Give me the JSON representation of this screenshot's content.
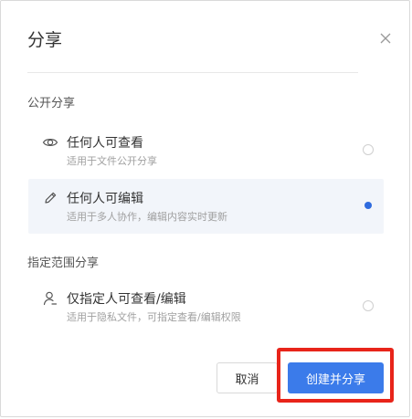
{
  "dialog": {
    "title": "分享",
    "close_icon": "close-icon"
  },
  "public_section": {
    "title": "公开分享",
    "options": [
      {
        "icon": "eye-icon",
        "label": "任何人可查看",
        "description": "适用于文件公开分享",
        "selected": false
      },
      {
        "icon": "pencil-icon",
        "label": "任何人可编辑",
        "description": "适用于多人协作，编辑内容实时更新",
        "selected": true
      }
    ]
  },
  "scoped_section": {
    "title": "指定范围分享",
    "options": [
      {
        "icon": "user-icon",
        "label": "仅指定人可查看/编辑",
        "description": "适用于隐私文件，可指定查看/编辑权限",
        "selected": false
      }
    ]
  },
  "footer": {
    "cancel_label": "取消",
    "confirm_label": "创建并分享"
  },
  "colors": {
    "primary": "#3b7bea",
    "highlight": "#e8241a",
    "selected_bg": "#f2f5fa"
  }
}
